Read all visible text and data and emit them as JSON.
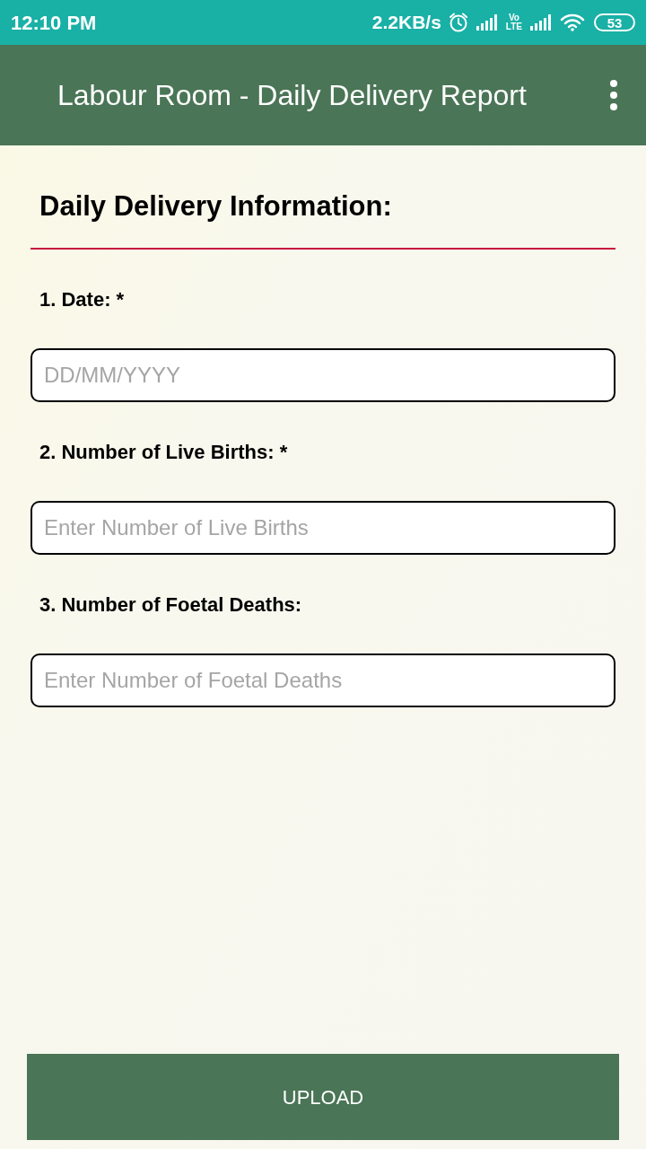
{
  "status_bar": {
    "time": "12:10 PM",
    "network_speed": "2.2KB/s",
    "volte_top": "Vo",
    "volte_bottom": "LTE",
    "battery": "53"
  },
  "app_bar": {
    "title": "Labour Room - Daily Delivery Report"
  },
  "form": {
    "heading": "Daily Delivery Information:",
    "fields": [
      {
        "label": "1. Date: *",
        "placeholder": "DD/MM/YYYY"
      },
      {
        "label": "2. Number of Live Births: *",
        "placeholder": "Enter Number of Live Births"
      },
      {
        "label": "3. Number of Foetal Deaths:",
        "placeholder": "Enter Number of Foetal Deaths"
      }
    ]
  },
  "upload_button": {
    "label": "UPLOAD"
  }
}
